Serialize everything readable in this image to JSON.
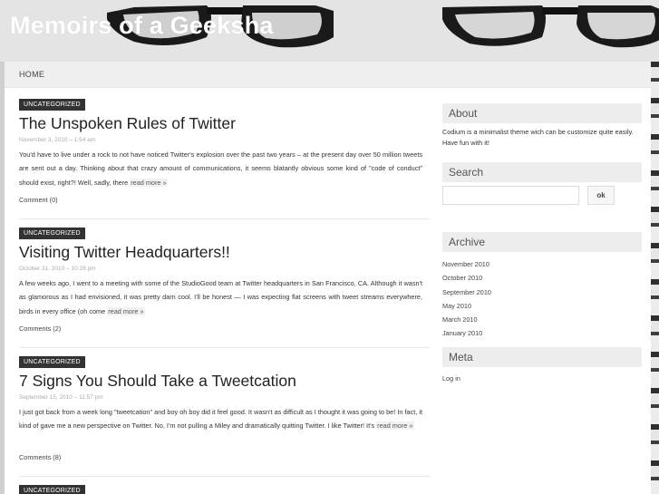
{
  "site": {
    "title": "Memoirs of a Geeksha"
  },
  "nav": {
    "home": "HOME"
  },
  "posts": [
    {
      "category": "UNCATEGORIZED",
      "title": "The Unspoken Rules of Twitter",
      "date": "November 3, 2010 – 1:54 am",
      "excerpt": "You'd have to live under a rock to not have noticed Twitter's explosion over the past two years  – at the present day over 50 million tweets are sent out a day. Thinking about that crazy amount of communications, it seems blatantly obvious some kind of \"code of conduct\" should exist, right?! Well, sadly, there ",
      "read_more": "read more »",
      "comments": "Comment (0)"
    },
    {
      "category": "UNCATEGORIZED",
      "title": "Visiting Twitter Headquarters!!",
      "date": "October 31, 2010 – 10:28 pm",
      "excerpt": "A few weeks ago, I went to a meeting with some of the StudioGood team at Twitter headquarters in San Francisco, CA. Although it wasn't as glamorous as I had envisioned, it was pretty darn cool. I'll be honest — I was expecting flat screens with tweet streams everywhere, birds in every office (oh come ",
      "read_more": "read more »",
      "comments": "Comments (2)"
    },
    {
      "category": "UNCATEGORIZED",
      "title": "7 Signs You Should Take a Tweetcation",
      "date": "September 15, 2010 – 11:57 pm",
      "excerpt": "I just got back from a week long \"tweetcation\" and boy oh boy did it feel good. It wasn't as difficult as I thought it was going to be!  In fact, it kind of gave me a new perspective on Twitter. No, I'm not pulling a Miley and dramatically quitting Twitter. I like Twitter! It's ",
      "read_more": "read more »",
      "comments": "Comments (8)"
    },
    {
      "category": "UNCATEGORIZED"
    }
  ],
  "sidebar": {
    "about": {
      "title": "About",
      "text": "Codium is a minimalist theme wich can be customize quite easily. Have fun with it!"
    },
    "search": {
      "title": "Search",
      "placeholder": "",
      "button": "ok"
    },
    "archive": {
      "title": "Archive",
      "items": [
        "November 2010",
        "October 2010",
        "September 2010",
        "May 2010",
        "March 2010",
        "January 2010"
      ]
    },
    "meta": {
      "title": "Meta",
      "items": [
        "Log in"
      ]
    }
  }
}
